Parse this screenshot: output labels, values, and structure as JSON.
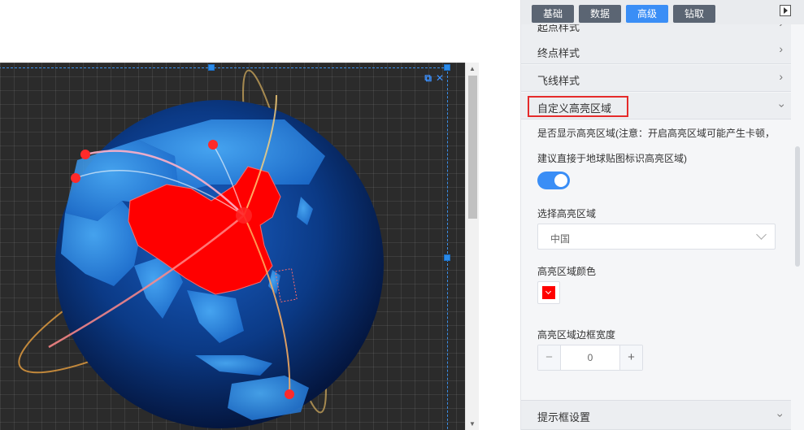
{
  "tabs": [
    {
      "label": "基础",
      "active": false
    },
    {
      "label": "数据",
      "active": false
    },
    {
      "label": "高级",
      "active": true
    },
    {
      "label": "钻取",
      "active": false
    }
  ],
  "sections": {
    "start_point": "起点样式",
    "end_point": "终点样式",
    "flight_line": "飞线样式",
    "custom_highlight": "自定义高亮区域",
    "tooltip": "提示框设置"
  },
  "highlight": {
    "show_label_line1": "是否显示高亮区域(注意：开启高亮区域可能产生卡顿，",
    "show_label_line2": "建议直接于地球贴图标识高亮区域)",
    "show_enabled": true,
    "region_label": "选择高亮区域",
    "region_value": "中国",
    "color_label": "高亮区域颜色",
    "color_value": "#ff0000",
    "border_label": "高亮区域边框宽度",
    "border_value": "0",
    "minus": "−",
    "plus": "+"
  },
  "widget": {
    "popout_icon": "popout-icon",
    "close_icon": "close-icon"
  },
  "colors": {
    "accent": "#3a8ef6",
    "tab_inactive": "#5b6573",
    "highlight_outline": "#e52b2b",
    "globe_ocean": "#0b3a86",
    "highlight_region": "#ff0000"
  }
}
